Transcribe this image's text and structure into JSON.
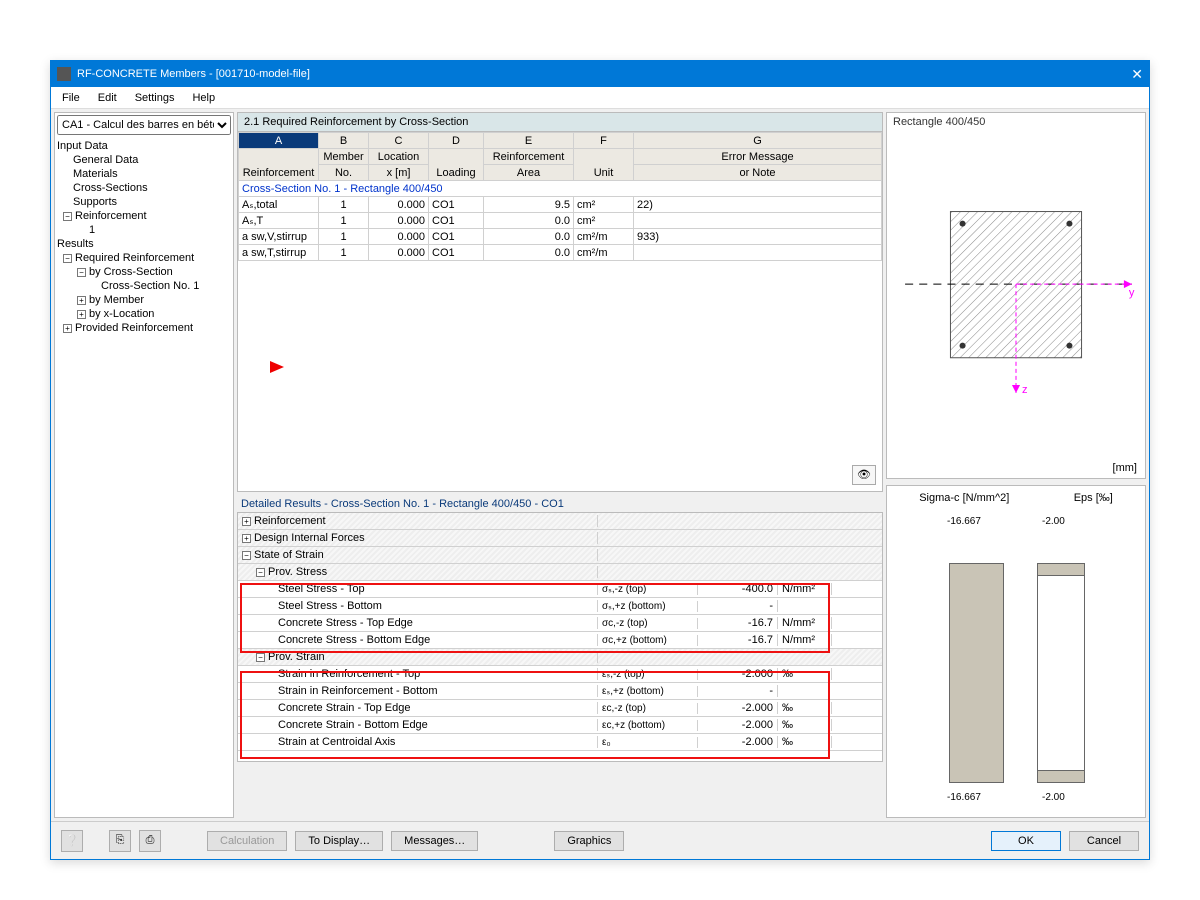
{
  "title": "RF-CONCRETE Members - [001710-model-file]",
  "menu": [
    "File",
    "Edit",
    "Settings",
    "Help"
  ],
  "combo": "CA1 - Calcul des barres en bétc",
  "tree": {
    "input": "Input Data",
    "items1": [
      "General Data",
      "Materials",
      "Cross-Sections",
      "Supports"
    ],
    "reinf": "Reinforcement",
    "r1": "1",
    "results": "Results",
    "rr": "Required Reinforcement",
    "bycs": "by Cross-Section",
    "csn1": "Cross-Section No. 1",
    "bym": "by Member",
    "byx": "by x-Location",
    "prov": "Provided Reinforcement"
  },
  "mainTitle": "2.1 Required Reinforcement by Cross-Section",
  "cols": {
    "A": "A",
    "B": "B",
    "C": "C",
    "D": "D",
    "E": "E",
    "F": "F",
    "G": "G"
  },
  "hdr2": {
    "A": "Reinforcement",
    "B": "Member\nNo.",
    "C": "Location\nx [m]",
    "D": "Loading",
    "E": "Reinforcement\nArea",
    "F": "Unit",
    "G": "Error Message\nor Note"
  },
  "sectRow": "Cross-Section No. 1 - Rectangle 400/450",
  "rows": [
    {
      "A": "Aₛ,total",
      "B": "1",
      "C": "0.000",
      "D": "CO1",
      "E": "9.5",
      "F": "cm²",
      "G": "22)"
    },
    {
      "A": "Aₛ,T",
      "B": "1",
      "C": "0.000",
      "D": "CO1",
      "E": "0.0",
      "F": "cm²",
      "G": ""
    },
    {
      "A": "a sw,V,stirrup",
      "B": "1",
      "C": "0.000",
      "D": "CO1",
      "E": "0.0",
      "F": "cm²/m",
      "G": "933)"
    },
    {
      "A": "a sw,T,stirrup",
      "B": "1",
      "C": "0.000",
      "D": "CO1",
      "E": "0.0",
      "F": "cm²/m",
      "G": ""
    }
  ],
  "detailTitle": "Detailed Results  -  Cross-Section No. 1 - Rectangle 400/450  -  CO1",
  "dheads": {
    "reinf": "Reinforcement",
    "dif": "Design Internal Forces",
    "sos": "State of Strain",
    "pstress": "Prov. Stress",
    "pstrain": "Prov. Strain"
  },
  "stress": [
    {
      "n": "Steel Stress - Top",
      "s": "σₛ,-z (top)",
      "v": "-400.0",
      "u": "N/mm²"
    },
    {
      "n": "Steel Stress - Bottom",
      "s": "σₛ,+z (bottom)",
      "v": "-",
      "u": ""
    },
    {
      "n": "Concrete Stress - Top Edge",
      "s": "σc,-z (top)",
      "v": "-16.7",
      "u": "N/mm²"
    },
    {
      "n": "Concrete Stress - Bottom Edge",
      "s": "σc,+z (bottom)",
      "v": "-16.7",
      "u": "N/mm²"
    }
  ],
  "strain": [
    {
      "n": "Strain in Reinforcement - Top",
      "s": "εₛ,-z (top)",
      "v": "-2.000",
      "u": "‰"
    },
    {
      "n": "Strain in Reinforcement - Bottom",
      "s": "εₛ,+z (bottom)",
      "v": "-",
      "u": ""
    },
    {
      "n": "Concrete Strain - Top Edge",
      "s": "εc,-z (top)",
      "v": "-2.000",
      "u": "‰"
    },
    {
      "n": "Concrete Strain - Bottom Edge",
      "s": "εc,+z (bottom)",
      "v": "-2.000",
      "u": "‰"
    },
    {
      "n": "Strain at Centroidal Axis",
      "s": "ε₀",
      "v": "-2.000",
      "u": "‰"
    }
  ],
  "rectTitle": "Rectangle 400/450",
  "mm": "[mm]",
  "sigmaTitle": "Sigma-c [N/mm^2]",
  "epsTitle": "Eps [‰]",
  "sigVal": "-16.667",
  "epsVal": "-2.00",
  "btns": {
    "calc": "Calculation",
    "disp": "To Display…",
    "msg": "Messages…",
    "gfx": "Graphics",
    "ok": "OK",
    "cancel": "Cancel"
  },
  "axes": {
    "y": "y",
    "z": "z"
  }
}
